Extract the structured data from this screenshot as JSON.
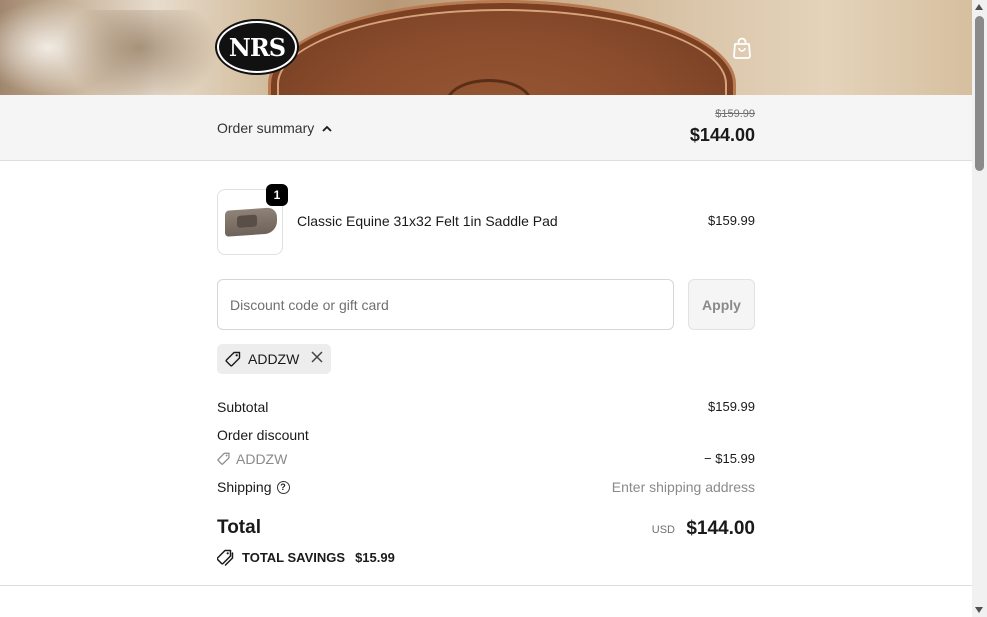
{
  "header": {
    "logo_text": "NRS",
    "cart_icon": "shopping-bag-icon"
  },
  "summary_bar": {
    "toggle_label": "Order summary",
    "toggle_icon": "chevron-up-icon",
    "original_total": "$159.99",
    "total": "$144.00"
  },
  "product": {
    "quantity": "1",
    "name": "Classic Equine 31x32 Felt 1in Saddle Pad",
    "price": "$159.99"
  },
  "discount": {
    "placeholder": "Discount code or gift card",
    "apply_label": "Apply",
    "applied_code": "ADDZW",
    "tag_icon": "tag-icon",
    "remove_icon": "close-icon"
  },
  "totals": {
    "subtotal_label": "Subtotal",
    "subtotal_value": "$159.99",
    "order_discount_label": "Order discount",
    "discount_code": "ADDZW",
    "discount_value": "− $15.99",
    "shipping_label": "Shipping",
    "shipping_value": "Enter shipping address",
    "total_label": "Total",
    "currency": "USD",
    "total_value": "$144.00",
    "savings_label": "TOTAL SAVINGS",
    "savings_value": "$15.99"
  },
  "colors": {
    "summary_bg": "#f5f5f5",
    "accent": "#000000"
  }
}
